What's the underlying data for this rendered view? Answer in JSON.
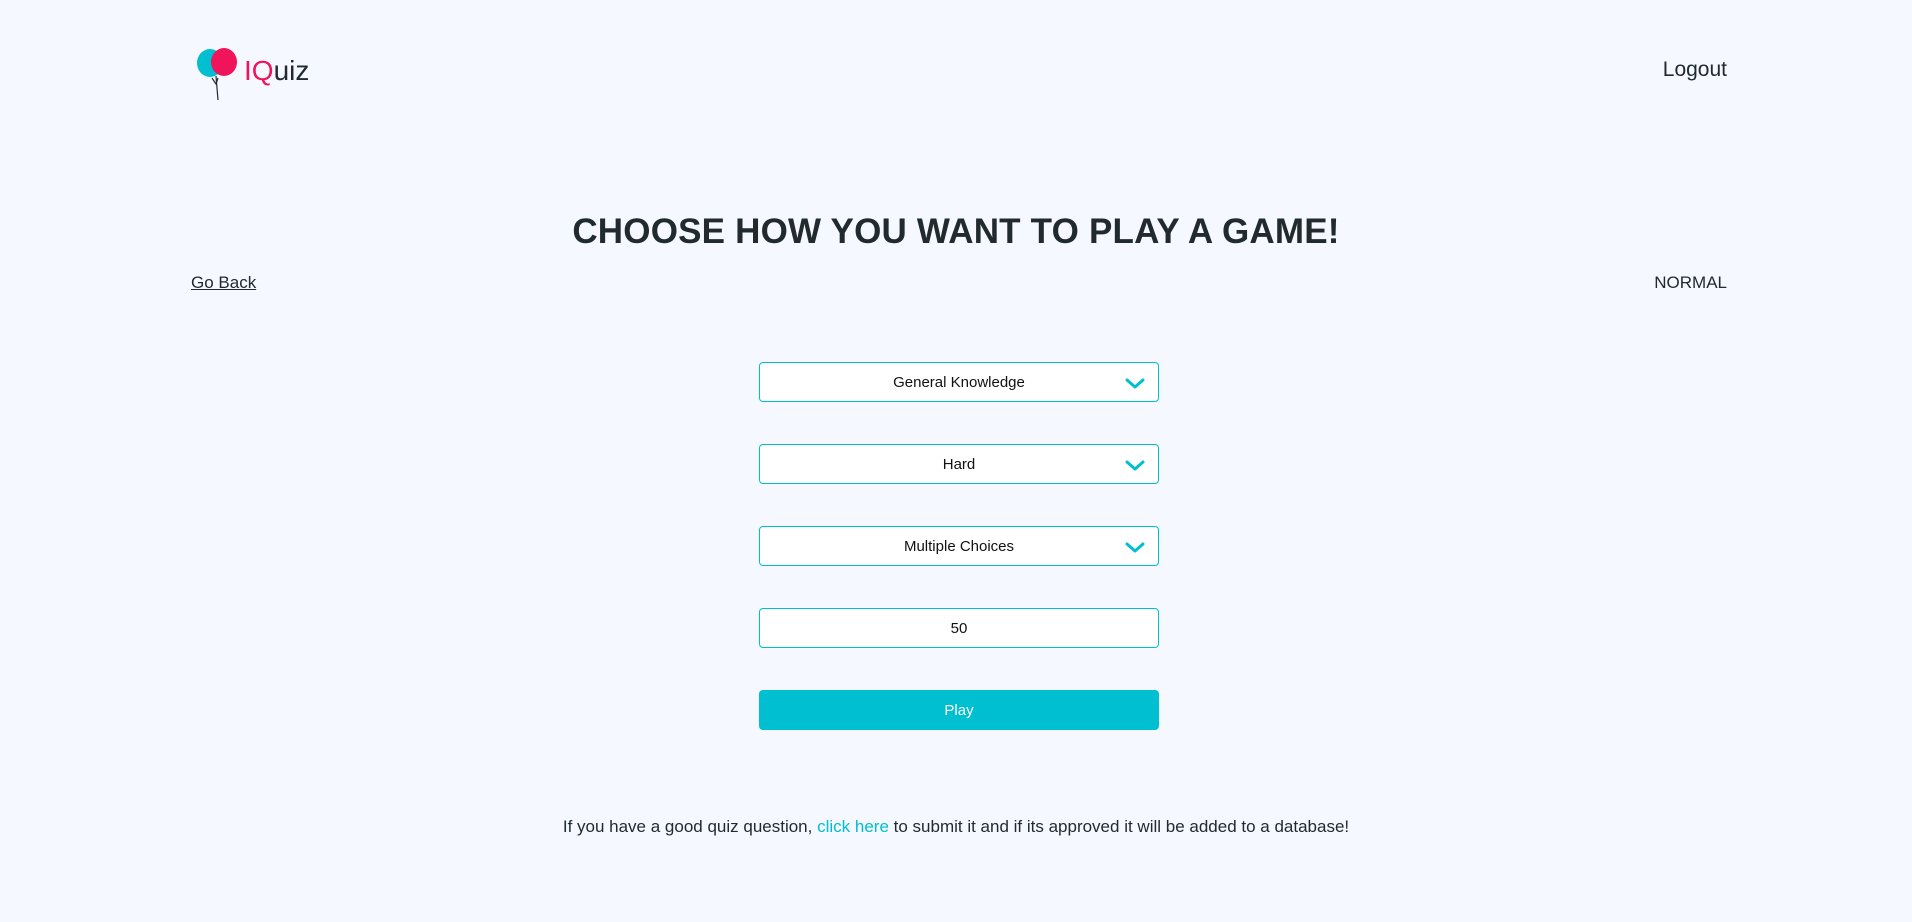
{
  "header": {
    "logo_prefix": "IQ",
    "logo_suffix": "uiz",
    "logout_label": "Logout"
  },
  "page": {
    "title": "CHOOSE HOW YOU WANT TO PLAY A GAME!",
    "go_back_label": "Go Back",
    "mode_label": "NORMAL"
  },
  "form": {
    "category_value": "General Knowledge",
    "difficulty_value": "Hard",
    "type_value": "Multiple Choices",
    "question_count_value": "50",
    "play_label": "Play"
  },
  "footer": {
    "text_before": "If you have a good quiz question, ",
    "link_text": "click here",
    "text_after": " to submit it and if its approved it will be added to a database!"
  },
  "icons": {
    "logo": "balloons-icon",
    "dropdown": "chevron-down-icon"
  },
  "colors": {
    "accent": "#00bfd0",
    "brand_pink": "#f0145a",
    "background": "#f5f8fe",
    "text": "#212b2e"
  }
}
